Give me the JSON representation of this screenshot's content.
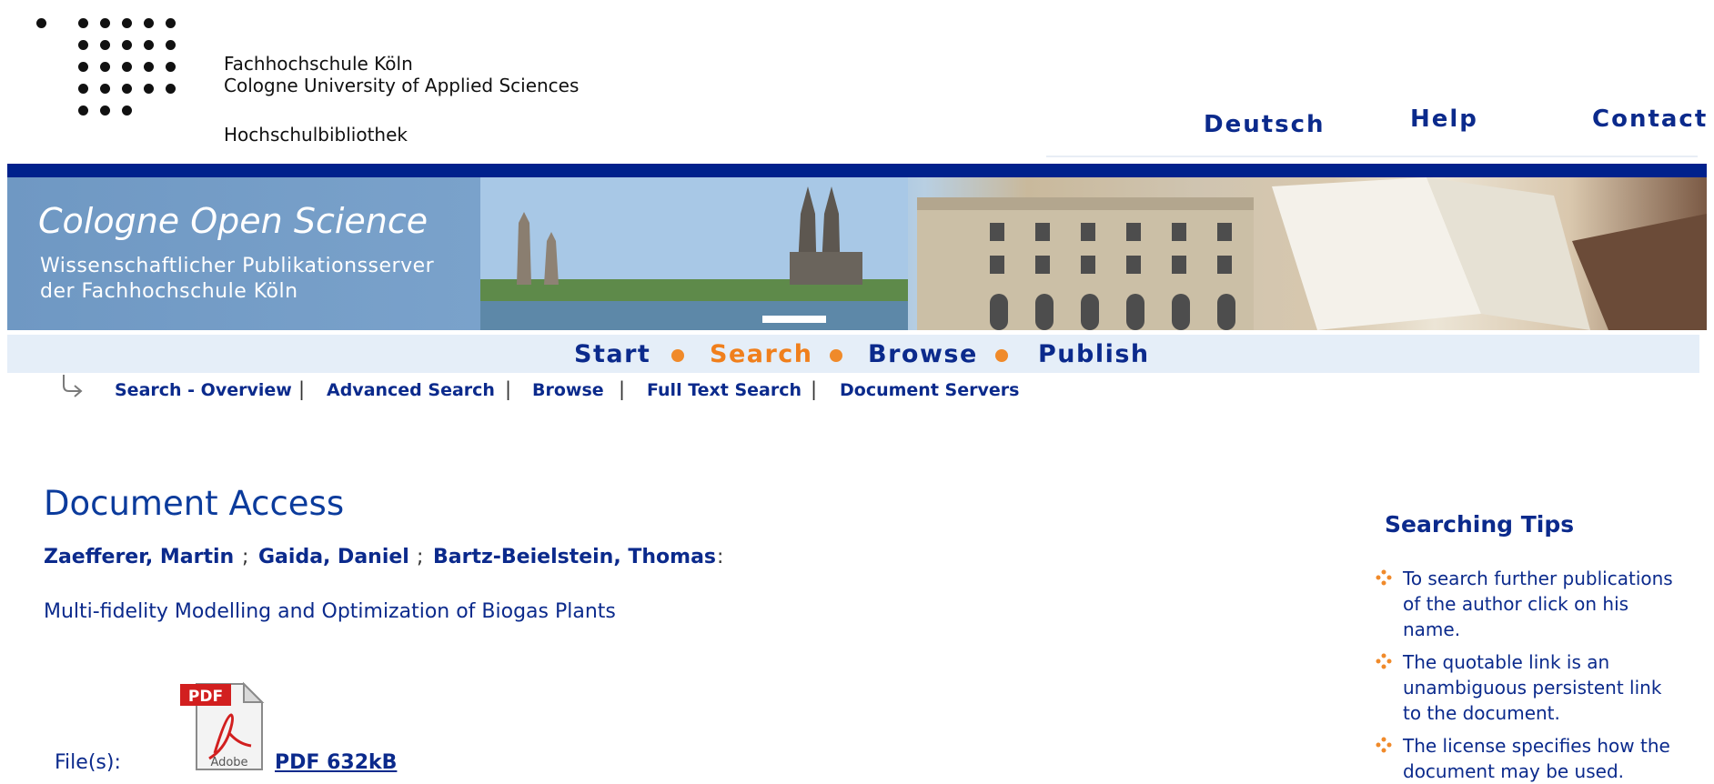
{
  "header": {
    "institution_line1": "Fachhochschule Köln",
    "institution_line2": "Cologne University of Applied Sciences",
    "library": "Hochschulbibliothek",
    "links": [
      "Deutsch",
      "Help",
      "Contact"
    ]
  },
  "banner": {
    "title": "Cologne Open Science",
    "subtitle_line1": "Wissenschaftlicher Publikationsserver",
    "subtitle_line2": "der Fachhochschule Köln"
  },
  "main_nav": [
    {
      "label": "Start",
      "active": false
    },
    {
      "label": "Search",
      "active": true
    },
    {
      "label": "Browse",
      "active": false
    },
    {
      "label": "Publish",
      "active": false
    }
  ],
  "sub_nav": [
    "Search - Overview",
    "Advanced Search",
    "Browse",
    "Full Text Search",
    "Document Servers"
  ],
  "document": {
    "page_title": "Document Access",
    "authors": [
      "Zaefferer, Martin",
      "Gaida, Daniel",
      "Bartz-Beielstein, Thomas"
    ],
    "title": "Multi-fidelity Modelling and Optimization of Biogas Plants",
    "files_label": "File(s):",
    "pdf_label": "PDF",
    "pdf_link": " PDF 632kB",
    "pdf_icon_caption": "Adobe"
  },
  "sidebar": {
    "title": "Searching Tips",
    "tips": [
      "To search further publications of the author click on his name.",
      "The quotable link is an unambiguous persistent link to the document.",
      "The license specifies how the document may be used."
    ]
  },
  "colors": {
    "navy": "#0b2a8c",
    "accent_orange": "#f07f1c",
    "banner_bar": "#00218c",
    "nav_background": "#e5eef8"
  }
}
